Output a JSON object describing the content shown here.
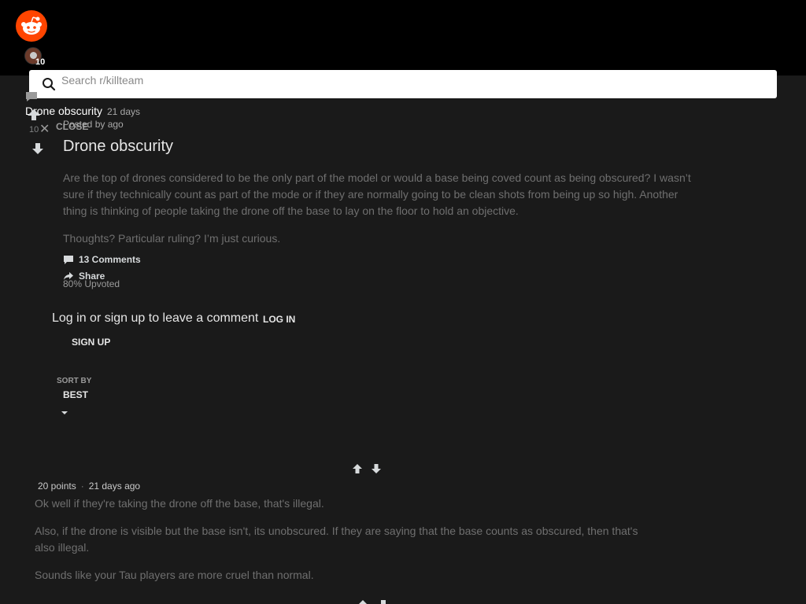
{
  "header": {
    "avatar_count": "10",
    "search_placeholder": "Search r/killteam"
  },
  "post": {
    "title_small": "Drone obscurity",
    "age_small": "21 days",
    "close_label": "CLOSE",
    "posted_by": "Posted by ago",
    "vote_count": "10",
    "title": "Drone obscurity",
    "body": [
      "Are the top of drones considered to be the only part of the model or would a base being coved count as being obscured? I wasn’t sure if they technically count as part of the mode or if they are normally going to be clean shots from being up so high. Another thing is thinking of people taking the drone off the base to lay on the floor to hold an objective.",
      "Thoughts? Particular ruling? I’m just curious."
    ],
    "comments_label": "13 Comments",
    "share_label": "Share",
    "upvoted_label": "80% Upvoted"
  },
  "auth": {
    "prompt": "Log in or sign up to leave a comment",
    "login_label": "LOG IN",
    "signup_label": "SIGN UP"
  },
  "sort": {
    "label": "SORT BY",
    "value": "BEST"
  },
  "comments": [
    {
      "points": "20 points",
      "age": "21 days ago",
      "body": [
        "Ok well if they're taking the drone off the base, that's illegal.",
        "Also, if the drone is visible but the base isn't, its unobscured. If they are saying that the base counts as obscured, then that's also illegal.",
        "Sounds like your Tau players are more cruel than normal."
      ]
    }
  ],
  "colors": {
    "brand": "#ff4500",
    "background": "#1a1a1a",
    "topbar": "#000000"
  }
}
